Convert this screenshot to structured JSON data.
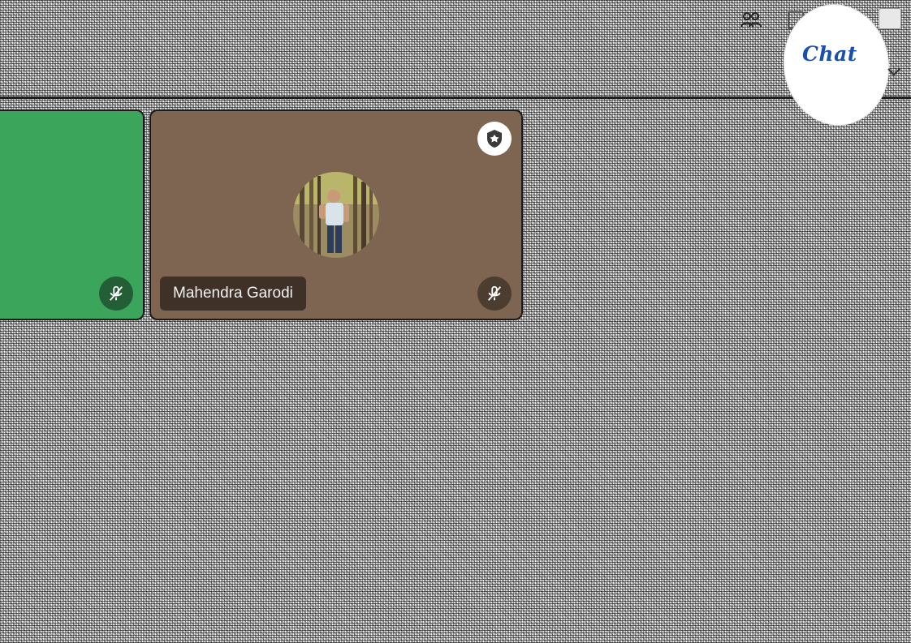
{
  "participants": [
    {
      "id": "green",
      "background": "#3aa55b",
      "muted": true,
      "name": ""
    },
    {
      "id": "mahendra",
      "background": "#7e6551",
      "muted": true,
      "name": "Mahendra Garodi",
      "badge_icon": "shield-icon",
      "avatar": "profile-photo"
    }
  ],
  "chat": {
    "label": "Chat"
  },
  "icons": {
    "mic_off": "mic-off-icon",
    "host": "shield-icon",
    "people": "people-icon",
    "expand": "chevron-down-icon"
  },
  "colors": {
    "chat_text": "#1a4fb0",
    "tile_border": "#1b1b1b"
  }
}
